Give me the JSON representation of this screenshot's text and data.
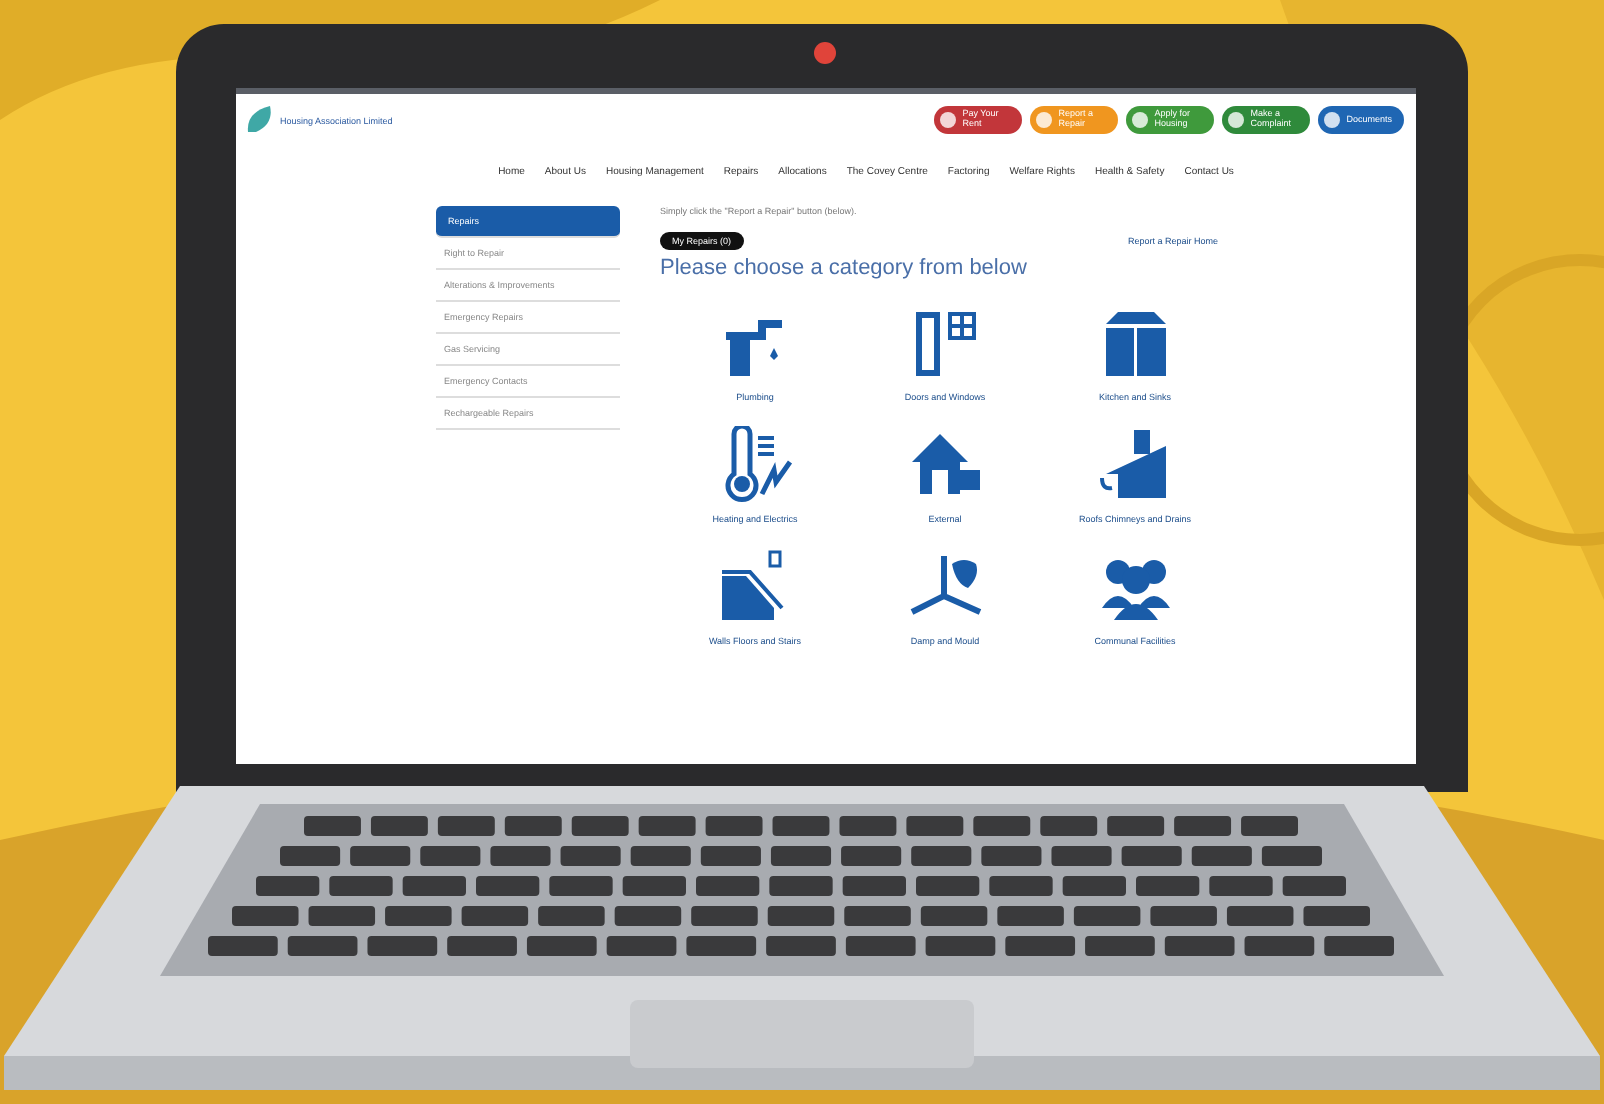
{
  "header": {
    "logo_text": "Housing Association Limited",
    "buttons": [
      {
        "label": "Pay Your Rent",
        "color": "#c2363a"
      },
      {
        "label": "Report a Repair",
        "color": "#f0961f"
      },
      {
        "label": "Apply for Housing",
        "color": "#3f9a3c"
      },
      {
        "label": "Make a Complaint",
        "color": "#2f8a3b"
      },
      {
        "label": "Documents",
        "color": "#1f66b3"
      }
    ]
  },
  "nav": [
    "Home",
    "About Us",
    "Housing Management",
    "Repairs",
    "Allocations",
    "The Covey Centre",
    "Factoring",
    "Welfare Rights",
    "Health & Safety",
    "Contact Us"
  ],
  "sidebar": {
    "items": [
      {
        "label": "Repairs",
        "selected": true
      },
      {
        "label": "Right to Repair",
        "selected": false
      },
      {
        "label": "Alterations & Improvements",
        "selected": false
      },
      {
        "label": "Emergency Repairs",
        "selected": false
      },
      {
        "label": "Gas Servicing",
        "selected": false
      },
      {
        "label": "Emergency Contacts",
        "selected": false
      },
      {
        "label": "Rechargeable Repairs",
        "selected": false
      }
    ]
  },
  "main": {
    "intro": "Simply click the \"Report a Repair\" button (below).",
    "my_repairs": "My Repairs (0)",
    "home_link": "Report a Repair Home",
    "heading": "Please choose a category from below",
    "categories": [
      "Plumbing",
      "Doors and Windows",
      "Kitchen and Sinks",
      "Heating and Electrics",
      "External",
      "Roofs Chimneys and Drains",
      "Walls Floors and Stairs",
      "Damp and Mould",
      "Communal Facilities"
    ]
  }
}
